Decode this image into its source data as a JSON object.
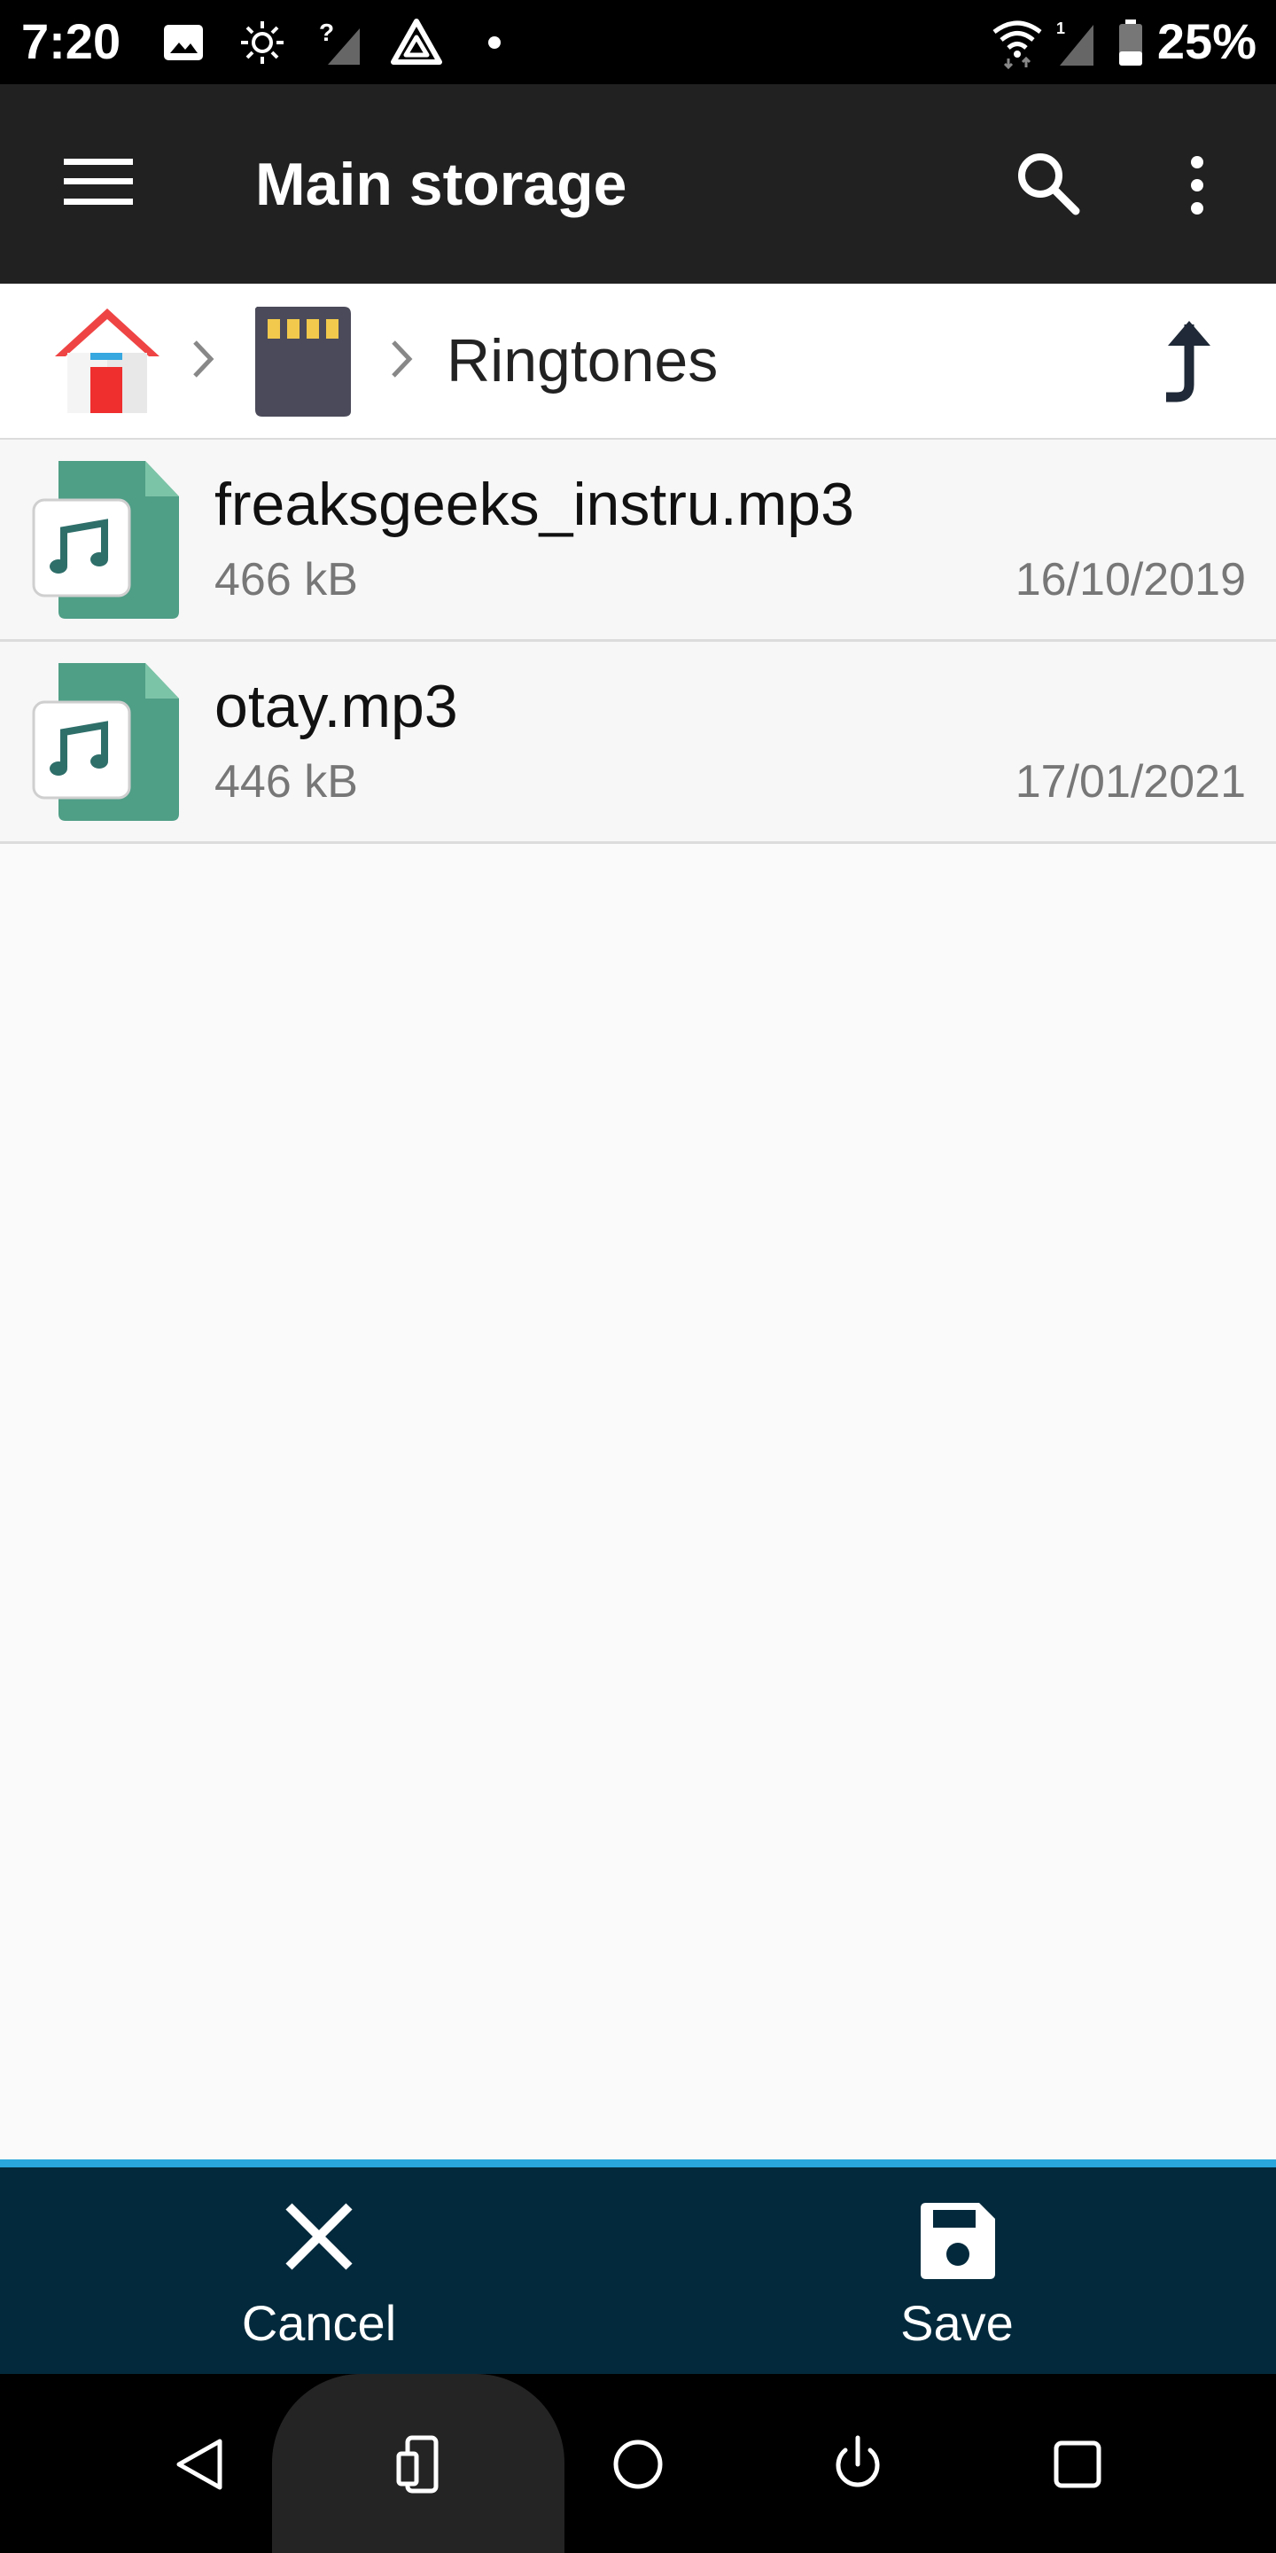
{
  "status_bar": {
    "time": "7:20",
    "battery": "25%",
    "icons": [
      "image-icon",
      "brightness-icon",
      "no-signal-icon",
      "app-triangle-icon",
      "dot-icon",
      "wifi-icon",
      "signal-icon",
      "battery-icon"
    ]
  },
  "app_bar": {
    "title": "Main storage",
    "icons": [
      "menu-icon",
      "search-icon",
      "more-vert-icon"
    ]
  },
  "breadcrumb": {
    "items": [
      "home-icon",
      "sd-card-icon"
    ],
    "current": "Ringtones",
    "up_icon": "arrow-up-icon"
  },
  "files": [
    {
      "name": "freaksgeeks_instru.mp3",
      "size": "466 kB",
      "date": "16/10/2019",
      "icon": "audio-file-icon"
    },
    {
      "name": "otay.mp3",
      "size": "446 kB",
      "date": "17/01/2021",
      "icon": "audio-file-icon"
    }
  ],
  "actions": {
    "cancel_label": "Cancel",
    "save_label": "Save"
  },
  "colors": {
    "app_bar": "#212121",
    "action_bar": "#032a3c",
    "accent": "#29a6dc",
    "file_icon": "#4f9e86"
  }
}
